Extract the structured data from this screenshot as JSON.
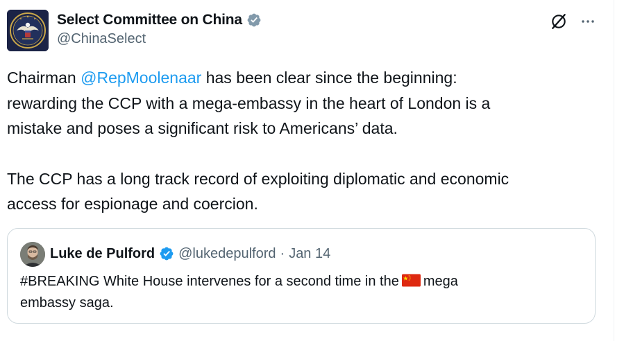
{
  "author": {
    "display_name": "Select Committee on China",
    "handle": "@ChinaSelect",
    "verified_badge_icon": "verified-badge-icon",
    "avatar_icon": "committee-seal-icon"
  },
  "actions": {
    "grok_icon": "grok-icon",
    "more_icon": "more-icon"
  },
  "tweet": {
    "p1_prefix": "Chairman ",
    "p1_mention": "@RepMoolenaar",
    "p1_line1_rest": " has been clear since the beginning:",
    "p1_line2": "rewarding the CCP with a mega-embassy in the heart of London is a",
    "p1_line3": "mistake and poses a significant risk to Americans’ data.",
    "p2_line1": "The CCP has a long track record of exploiting diplomatic and economic",
    "p2_line2": "access for espionage and coercion."
  },
  "quoted": {
    "display_name": "Luke de Pulford",
    "handle": "@lukedepulford",
    "separator": "·",
    "date": "Jan 14",
    "text_line1_before": "#BREAKING White House intervenes for a second time in the",
    "flag_icon": "china-flag-icon",
    "text_line1_after": "mega",
    "text_line2": "embassy saga."
  },
  "colors": {
    "accent": "#1d9bf0",
    "text": "#0f1419",
    "secondary_text": "#536471",
    "border": "#cfd9de"
  }
}
